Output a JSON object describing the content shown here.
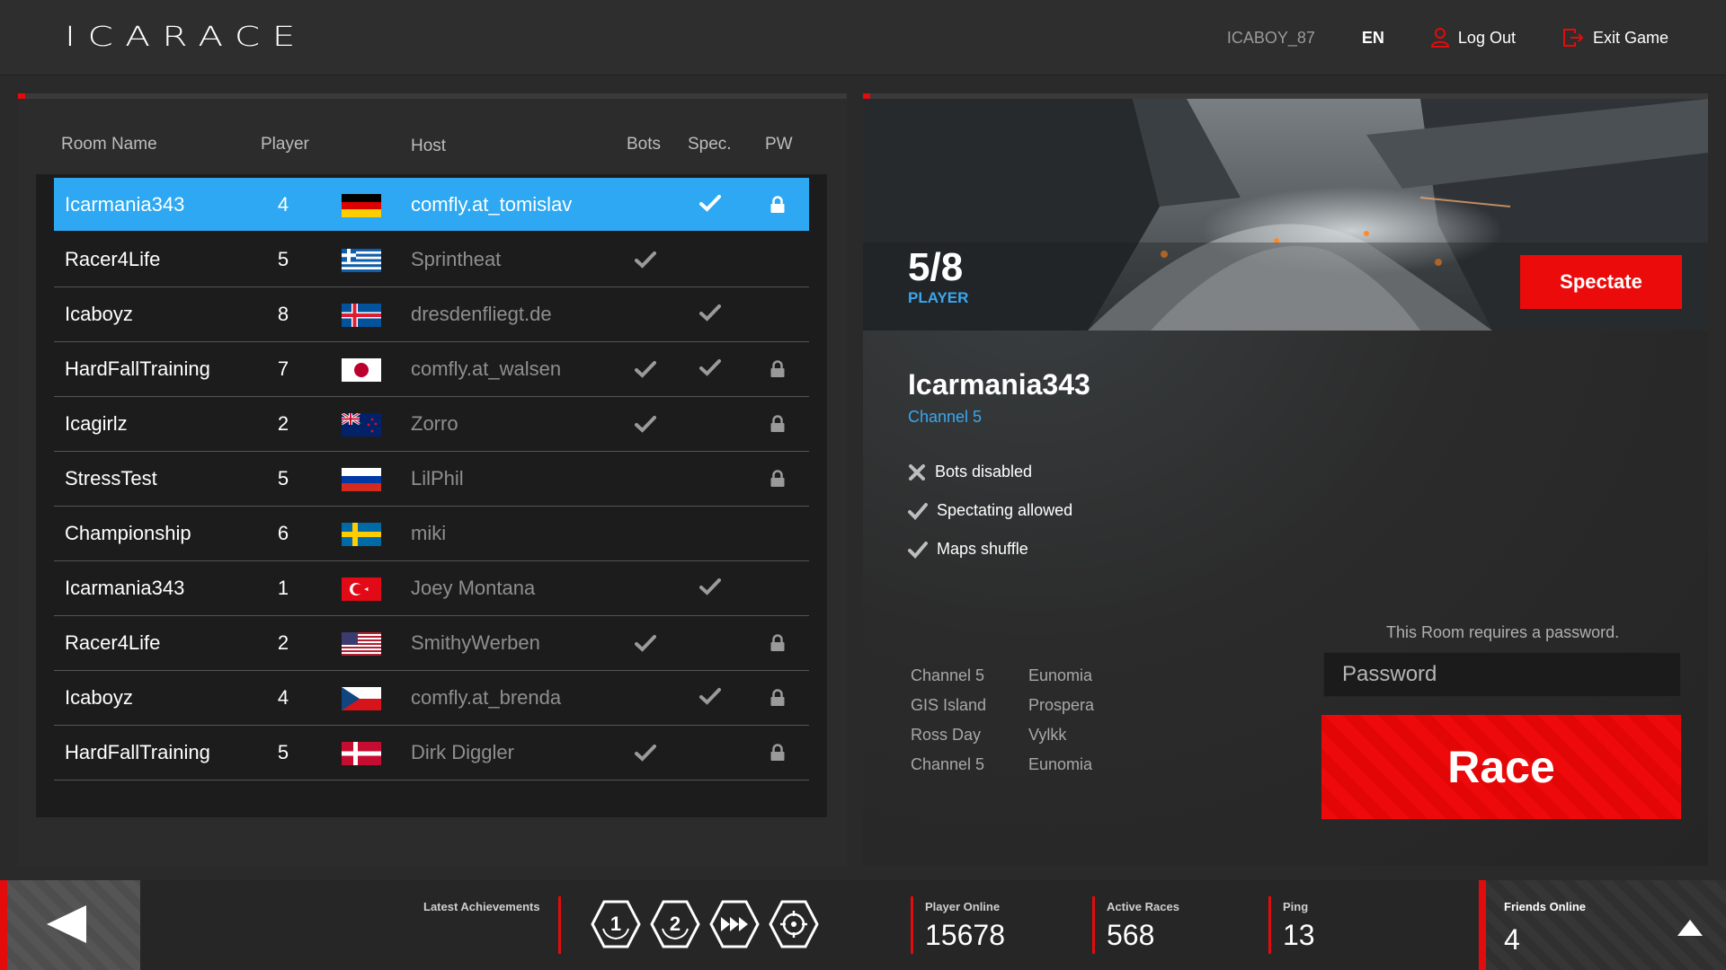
{
  "header": {
    "logo": "ICARACE",
    "username": "ICABOY_87",
    "language": "EN",
    "logout_label": "Log Out",
    "exit_label": "Exit Game"
  },
  "table": {
    "columns": {
      "room_name": "Room Name",
      "player": "Player",
      "host": "Host",
      "bots": "Bots",
      "spec": "Spec.",
      "pw": "PW"
    },
    "rows": [
      {
        "name": "Icarmania343",
        "players": "4",
        "flag": "de",
        "host": "comfly.at_tomislav",
        "bots": false,
        "spec": true,
        "pw": true,
        "selected": true
      },
      {
        "name": "Racer4Life",
        "players": "5",
        "flag": "gr",
        "host": "Sprintheat",
        "bots": true,
        "spec": false,
        "pw": false
      },
      {
        "name": "Icaboyz",
        "players": "8",
        "flag": "is",
        "host": "dresdenfliegt.de",
        "bots": false,
        "spec": true,
        "pw": false
      },
      {
        "name": "HardFallTraining",
        "players": "7",
        "flag": "jp",
        "host": "comfly.at_walsen",
        "bots": true,
        "spec": true,
        "pw": true
      },
      {
        "name": "Icagirlz",
        "players": "2",
        "flag": "nz",
        "host": "Zorro",
        "bots": true,
        "spec": false,
        "pw": true
      },
      {
        "name": "StressTest",
        "players": "5",
        "flag": "ru",
        "host": "LilPhil",
        "bots": false,
        "spec": false,
        "pw": true
      },
      {
        "name": "Championship",
        "players": "6",
        "flag": "se",
        "host": "miki",
        "bots": false,
        "spec": false,
        "pw": false
      },
      {
        "name": "Icarmania343",
        "players": "1",
        "flag": "tr",
        "host": "Joey Montana",
        "bots": false,
        "spec": true,
        "pw": false
      },
      {
        "name": "Racer4Life",
        "players": "2",
        "flag": "us",
        "host": "SmithyWerben",
        "bots": true,
        "spec": false,
        "pw": true
      },
      {
        "name": "Icaboyz",
        "players": "4",
        "flag": "cz",
        "host": "comfly.at_brenda",
        "bots": false,
        "spec": true,
        "pw": true
      },
      {
        "name": "HardFallTraining",
        "players": "5",
        "flag": "dk",
        "host": "Dirk Diggler",
        "bots": true,
        "spec": false,
        "pw": true
      }
    ]
  },
  "detail": {
    "player_count": "5/8",
    "player_label": "PLAYER",
    "spectate_label": "Spectate",
    "room_name": "Icarmania343",
    "channel": "Channel 5",
    "features": [
      {
        "icon": "cross-icon",
        "label": "Bots disabled"
      },
      {
        "icon": "check-icon",
        "label": "Spectating allowed"
      },
      {
        "icon": "check-icon",
        "label": "Maps shuffle"
      }
    ],
    "maps": [
      [
        "Channel 5",
        "Eunomia"
      ],
      [
        "GIS Island",
        "Prospera"
      ],
      [
        "Ross Day",
        "Vylkk"
      ],
      [
        "Channel 5",
        "Eunomia"
      ]
    ],
    "password_note": "This Room requires a password.",
    "password_placeholder": "Password",
    "race_label": "Race"
  },
  "footer": {
    "achievements_label": "Latest Achievements",
    "achievements": [
      "first-place-icon",
      "second-place-icon",
      "speed-icon",
      "target-icon"
    ],
    "player_online_label": "Player Online",
    "player_online": "15678",
    "active_races_label": "Active Races",
    "active_races": "568",
    "ping_label": "Ping",
    "ping": "13",
    "friends_label": "Friends Online",
    "friends_online": "4"
  },
  "colors": {
    "accent_red": "#e30b0b",
    "accent_blue": "#2ea8f2",
    "background": "#2a2a2a"
  }
}
